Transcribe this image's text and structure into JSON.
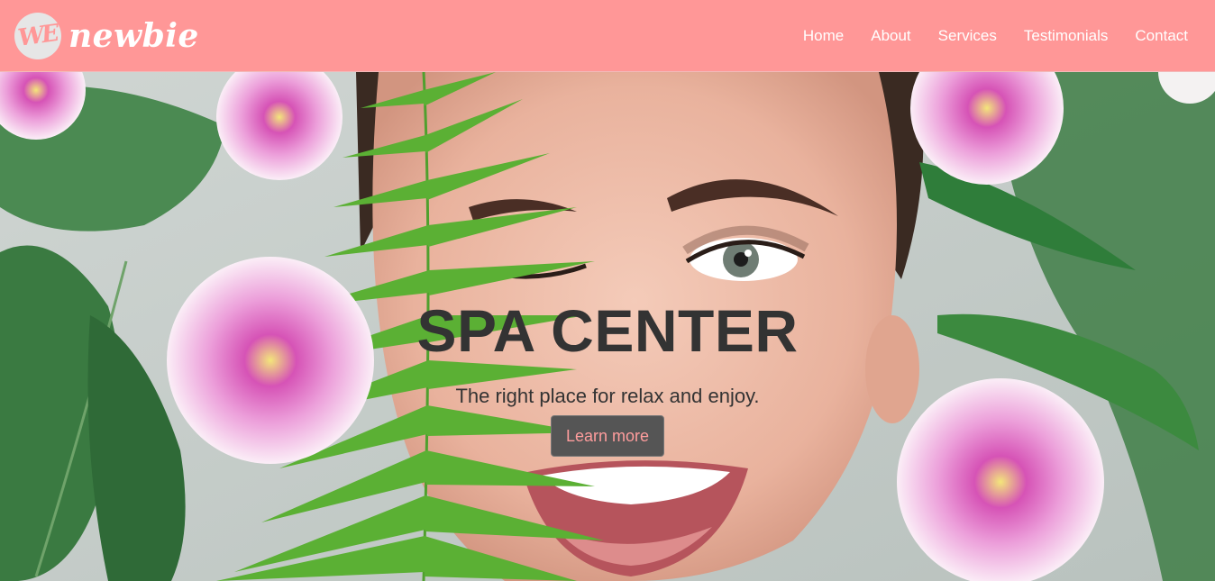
{
  "brand": {
    "mark": "WE",
    "name": "newbie"
  },
  "nav": {
    "items": [
      {
        "label": "Home"
      },
      {
        "label": "About"
      },
      {
        "label": "Services"
      },
      {
        "label": "Testimonials"
      },
      {
        "label": "Contact"
      }
    ]
  },
  "hero": {
    "title": "SPA CENTER",
    "subtitle": "The right place for relax and enjoy.",
    "button_label": "Learn more",
    "image_icon": "spa-face-photo"
  },
  "colors": {
    "navbar": "#ff9797",
    "nav_text": "#ffffff",
    "title_text": "#333333",
    "button_bg": "#555555",
    "button_text": "#ff9d9d"
  }
}
